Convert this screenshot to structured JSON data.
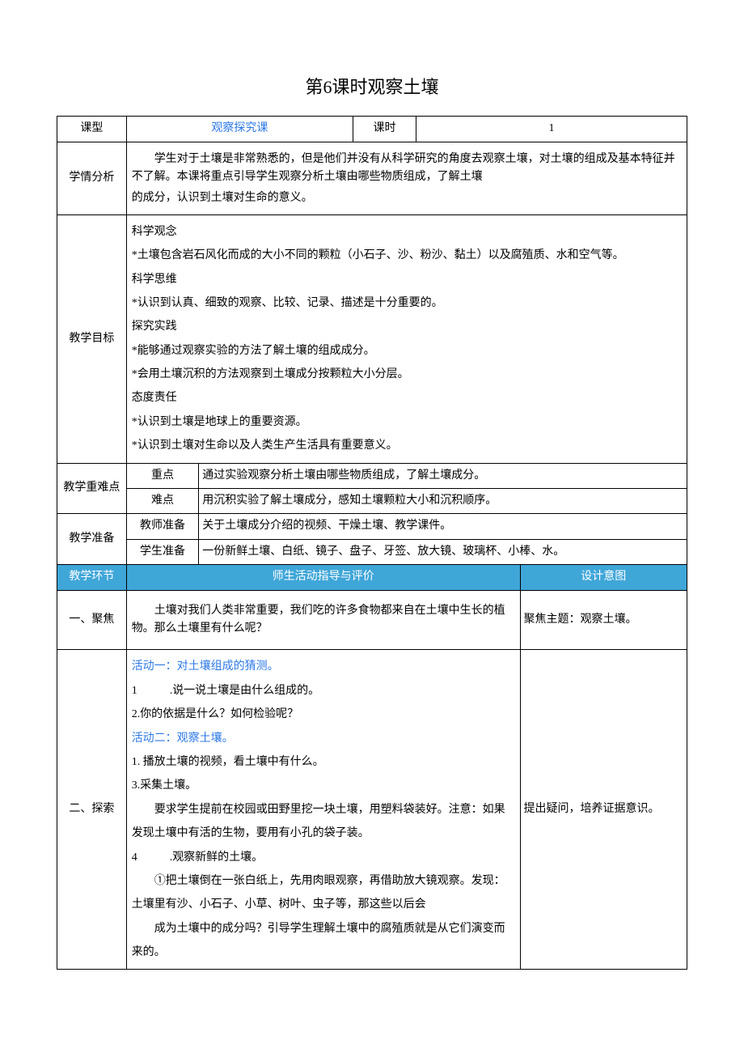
{
  "title": "第6课时观察土壤",
  "row1": {
    "label_type": "课型",
    "type_value": "观察探究课",
    "label_period": "课时",
    "period_value": "1"
  },
  "analysis": {
    "label": "学情分析",
    "p1": "学生对于土壤是非常熟悉的，但是他们并没有从科学研究的角度去观察土壤，对土壤的组成及基本特征并不了解。本课将重点引导学生观察分析土壤由哪些物质组成，了解土壤",
    "p2": "的成分，认识到土壤对生命的意义。"
  },
  "objectives": {
    "label": "教学目标",
    "h1": "科学观念",
    "l1": "*土壤包含岩石风化而成的大小不同的颗粒（小石子、沙、粉沙、黏土）以及腐殖质、水和空气等。",
    "h2": "科学思维",
    "l2": "*认识到认真、细致的观察、比较、记录、描述是十分重要的。",
    "h3": "探究实践",
    "l3a": "*能够通过观察实验的方法了解土壤的组成成分。",
    "l3b": "*会用土壤沉积的方法观察到土壤成分按颗粒大小分层。",
    "h4": "态度责任",
    "l4a": "*认识到土壤是地球上的重要资源。",
    "l4b": "*认识到土壤对生命以及人类生产生活具有重要意义。"
  },
  "keypoints": {
    "label": "教学重难点",
    "r1": {
      "h": "重点",
      "v": "通过实验观察分析土壤由哪些物质组成，了解土壤成分。"
    },
    "r2": {
      "h": "难点",
      "v": "用沉积实验了解土壤成分，感知土壤颗粒大小和沉积顺序。"
    }
  },
  "prep": {
    "label": "教学准备",
    "r1": {
      "h": "教师准备",
      "v": "关于土壤成分介绍的视频、干燥土壤、教学课件。"
    },
    "r2": {
      "h": "学生准备",
      "v": "一份新鲜土壤、白纸、镜子、盘子、牙签、放大镜、玻璃杯、小棒、水。"
    }
  },
  "header": {
    "c1": "教学环节",
    "c2": "师生活动指导与评价",
    "c3": "设计意图"
  },
  "focus": {
    "label": "一、聚焦",
    "body": "土壤对我们人类非常重要，我们吃的许多食物都来自在土壤中生长的植物。那么土壤里有什么呢？",
    "intent": "聚焦主题：观察土壤。"
  },
  "explore": {
    "label": "二、探索",
    "a1_title": "活动一：对土壤组成的猜测。",
    "a1_l1a": "1",
    "a1_l1b": ".说一说土壤是由什么组成的。",
    "a1_l2": "2.你的依据是什么？如何检验呢？",
    "a2_title": "活动二：观察土壤。",
    "a2_l1": "1. 播放土壤的视频，看土壤中有什么。",
    "a2_l3": "3.采集土壤。",
    "a2_req": "要求学生提前在校园或田野里挖一块土壤，用塑料袋装好。注意：如果发现土壤中有活的生物，要用有小孔的袋子装。",
    "a2_l4a": "4",
    "a2_l4b": ".观察新鲜的土壤。",
    "a2_p1": "①把土壤倒在一张白纸上，先用肉眼观察，再借助放大镜观察。发现：土壤里有沙、小石子、小草、树叶、虫子等，那这些以后会",
    "a2_p2": "成为土壤中的成分吗？引导学生理解土壤中的腐殖质就是从它们演变而来的。",
    "intent": "提出疑问，培养证据意识。"
  }
}
